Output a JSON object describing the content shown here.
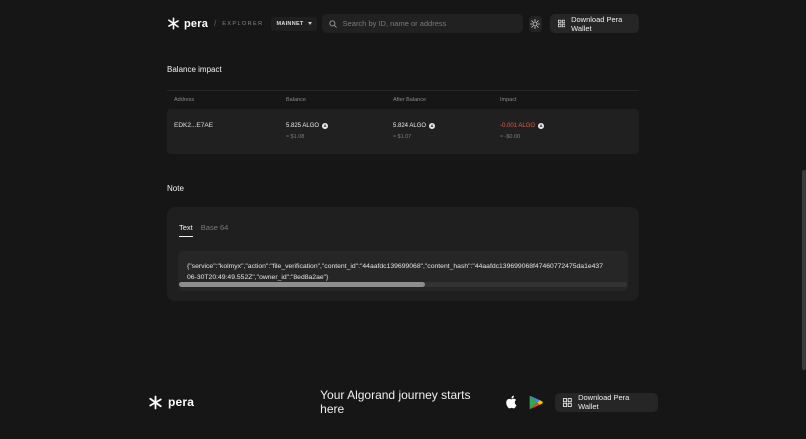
{
  "header": {
    "logo_text": "pera",
    "logo_sep": "/",
    "logo_sub": "EXPLORER",
    "network": "MAINNET",
    "search_placeholder": "Search by ID, name or address",
    "download_label": "Download Pera Wallet"
  },
  "balance": {
    "title": "Balance impact",
    "columns": [
      "Address",
      "Balance",
      "After Balance",
      "Impact"
    ],
    "row": {
      "address": "EDK2...E7AE",
      "balance": "5.825 ALGO",
      "balance_usd": "≈ $1.08",
      "after": "5.824 ALGO",
      "after_usd": "≈ $1.07",
      "impact": "-0.001 ALGO",
      "impact_usd": "≈ -$0.00"
    }
  },
  "note": {
    "title": "Note",
    "tabs": [
      "Text",
      "Base 64"
    ],
    "text_line1": "{\"service\":\"kolmyx\",\"action\":\"file_verification\",\"content_id\":\"44aafdc139699068\",\"content_hash\":\"44aafdc139699068f47460772475da1e437",
    "text_line2": "06-30T20:49:49.552Z\",\"owner_id\":\"8ed8a2ae\"}",
    "scroll_fraction": 0.55
  },
  "footer": {
    "logo_text": "pera",
    "tagline": "Your Algorand journey starts here",
    "download_label": "Download Pera Wallet"
  },
  "colors": {
    "background": "#161616",
    "card": "#1f1f1f",
    "negative": "#e35b4b"
  },
  "icons": [
    "pera-logo-icon",
    "chevron-down-icon",
    "search-icon",
    "sun-icon",
    "qr-grid-icon",
    "algo-icon",
    "apple-icon",
    "google-play-icon"
  ]
}
